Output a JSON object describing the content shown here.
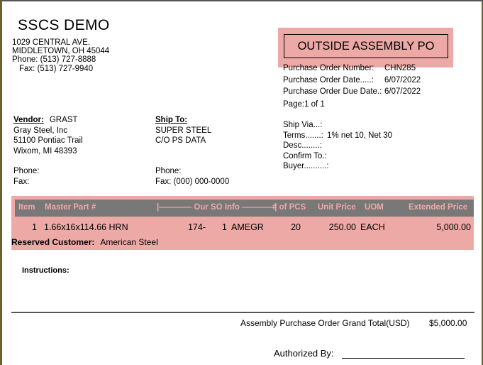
{
  "company": {
    "name": "SSCS DEMO",
    "address_line1": "1029 CENTRAL AVE.",
    "address_line2": "MIDDLETOWN, OH 45044",
    "phone": "Phone: (513) 727-8888",
    "fax": "Fax: (513) 727-9940"
  },
  "banner": {
    "title": "OUTSIDE ASSEMBLY PO"
  },
  "po_meta": {
    "number_label": "Purchase Order Number:",
    "number_value": "CHN285",
    "date_label": "Purchase Order Date.....:",
    "date_value": "6/07/2022",
    "due_date_label": "Purchase Order Due Date.:",
    "due_date_value": "6/07/2022",
    "page_label": "Page:",
    "page_value": "1 of 1"
  },
  "vendor": {
    "heading": "Vendor:",
    "code": "GRAST",
    "name": "Gray Steel, Inc",
    "street": "51100 Pontiac Trail",
    "city_state_zip": "Wixom, MI  48393",
    "phone_label": "Phone:",
    "phone_value": "",
    "fax_label": "Fax:",
    "fax_value": ""
  },
  "ship_to": {
    "heading": "Ship To:",
    "name": "SUPER STEEL",
    "line2": "C/O PS DATA",
    "phone_label": "Phone:",
    "phone_value": "",
    "fax_label": "Fax:",
    "fax_value": "(000) 000-0000"
  },
  "terms": {
    "ship_via_label": "Ship Via...:",
    "ship_via_value": "",
    "terms_label": "Terms.......:",
    "terms_value": "1% net 10, Net 30",
    "desc_label": "Desc........:",
    "desc_value": "",
    "confirm_to_label": "Confirm To.:",
    "confirm_to_value": "",
    "buyer_label": "Buyer..........:",
    "buyer_value": ""
  },
  "table": {
    "headers": {
      "item": "Item",
      "master_part": "Master Part #",
      "so_info": "|———— Our SO Info ————|",
      "pcs": "# of PCS",
      "unit_price": "Unit Price",
      "uom": "UOM",
      "extended_price": "Extended Price"
    },
    "rows": [
      {
        "item": "1",
        "master_part": "1.66x16x114.66 HRN",
        "so_number": "174-",
        "so_line": "1",
        "so_code": "AMEGR",
        "pcs": "20",
        "unit_price": "250.00",
        "uom": "EACH",
        "extended_price": "5,000.00"
      }
    ],
    "reserved_customer_label": "Reserved Customer:",
    "reserved_customer_value": "American Steel"
  },
  "instructions": {
    "label": "Instructions:"
  },
  "footer": {
    "grand_total_label": "Assembly Purchase Order Grand Total(USD)",
    "grand_total_value": "$5,000.00",
    "authorized_by_label": "Authorized By:"
  },
  "colors": {
    "pink_band": "#eda9a6",
    "header_gray": "#787878",
    "border_olive": "#6b6130"
  }
}
